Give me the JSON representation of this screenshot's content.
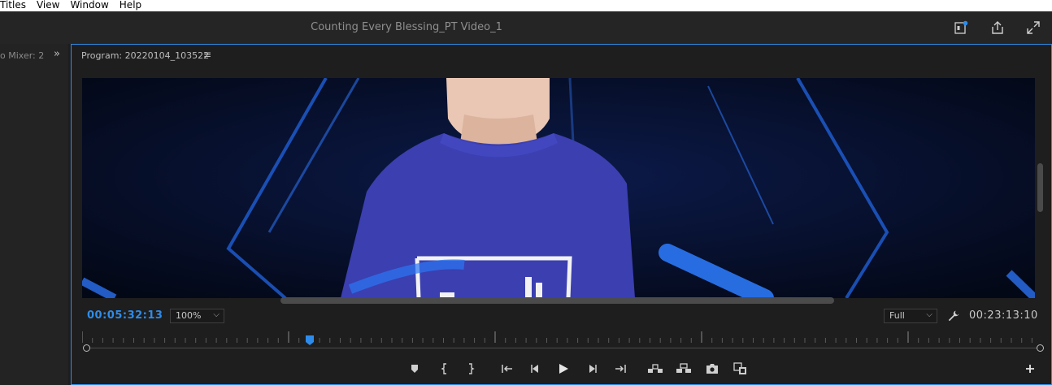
{
  "menubar": {
    "items": [
      "Titles",
      "View",
      "Window",
      "Help"
    ]
  },
  "titlebar": {
    "title": "Counting Every Blessing_PT Video_1",
    "icons": [
      "quick-export-badge-icon",
      "share-export-icon",
      "fullscreen-icon"
    ]
  },
  "left_panel": {
    "tab_label": "o Mixer: 2",
    "expand_icon": "double-chevron-right-icon"
  },
  "program": {
    "header": "Program: 20220104_103522",
    "menu_icon": "hamburger-icon",
    "timecode_current": "00:05:32:13",
    "timecode_duration": "00:23:13:10",
    "zoom_select": "100%",
    "resolution_select": "Full",
    "playhead_fraction": 0.238
  },
  "colors": {
    "accent": "#2d8ceb",
    "panel": "#1e1e1e",
    "video_bg": "#050c22",
    "shirt": "#3b3fb0"
  },
  "transport": [
    "add-marker-icon",
    "mark-in-icon",
    "mark-out-icon",
    "go-to-in-icon",
    "step-back-icon",
    "play-icon",
    "step-forward-icon",
    "go-to-out-icon",
    "lift-icon",
    "extract-icon",
    "export-frame-icon",
    "comparison-view-icon",
    "add-button-icon"
  ]
}
